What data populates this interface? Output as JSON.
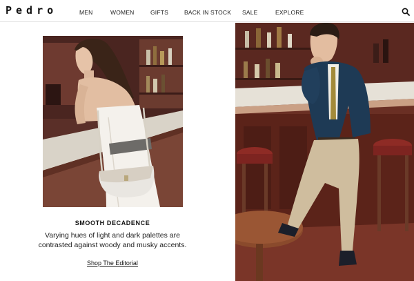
{
  "brand": {
    "logo": "Pedro"
  },
  "nav": {
    "items": [
      {
        "label": "MEN"
      },
      {
        "label": "WOMEN"
      },
      {
        "label": "GIFTS"
      },
      {
        "label": "BACK IN STOCK"
      },
      {
        "label": "SALE"
      },
      {
        "label": "EXPLORE"
      }
    ],
    "search_icon": "search-icon"
  },
  "feature": {
    "title": "SMOOTH DECADENCE",
    "body": "Varying hues of light and dark palettes are contrasted against woody and musky accents.",
    "link": "Shop The Editorial"
  }
}
